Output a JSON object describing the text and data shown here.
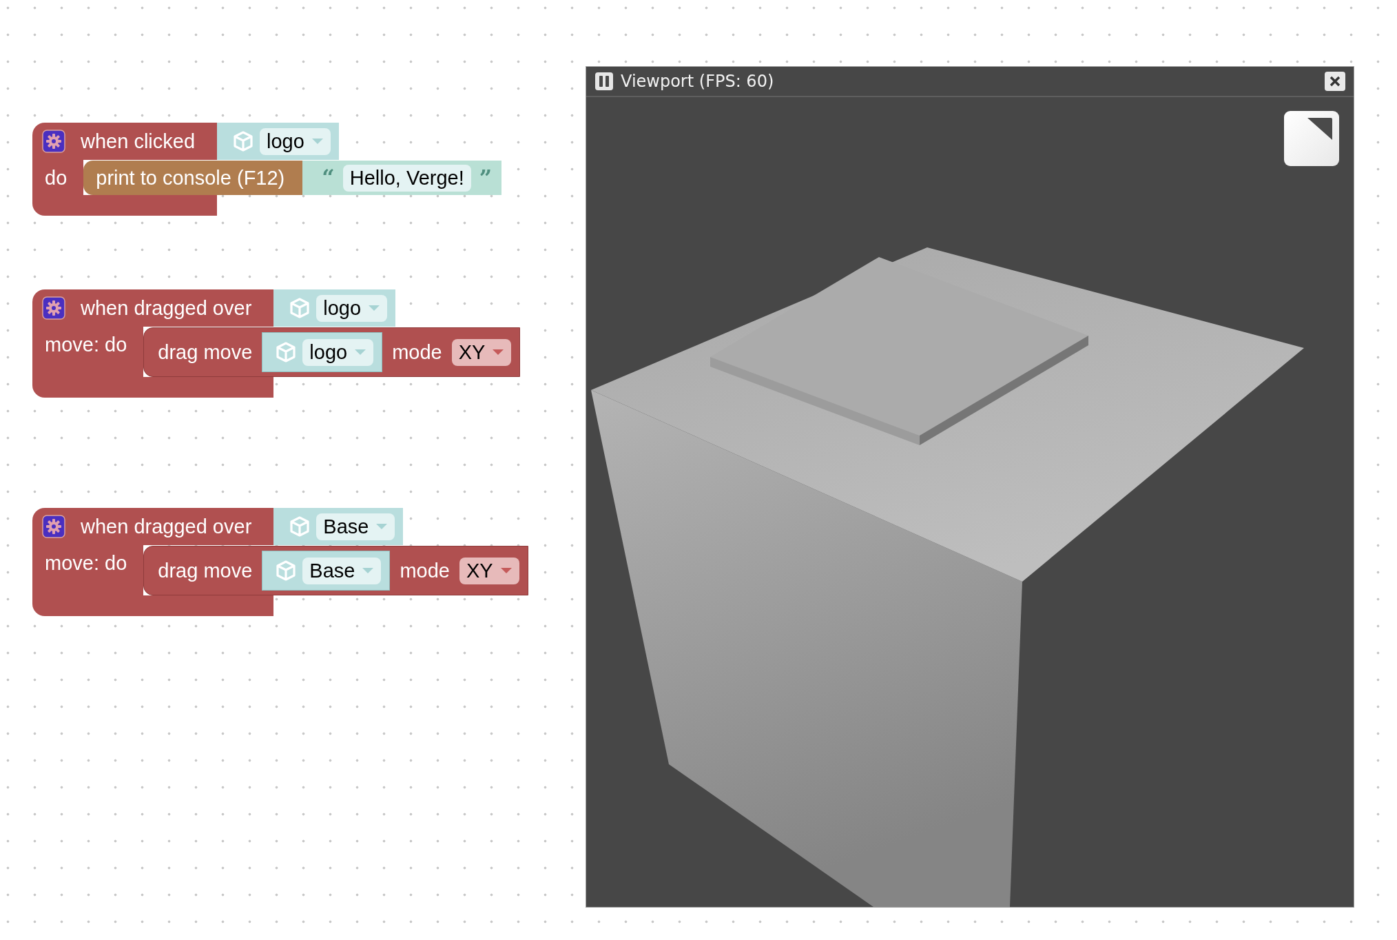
{
  "workspace": {
    "blocks": [
      {
        "kind": "event",
        "title": "when clicked",
        "target": {
          "value": "logo"
        },
        "body_label": "do",
        "statement": {
          "kind": "print",
          "label": "print to console (F12)",
          "text": {
            "open_quote": "“",
            "value": "Hello, Verge!",
            "close_quote": "”"
          }
        }
      },
      {
        "kind": "event",
        "title": "when dragged over",
        "target": {
          "value": "logo"
        },
        "body_label": "move: do",
        "statement": {
          "kind": "drag",
          "label": "drag move",
          "target": {
            "value": "logo"
          },
          "mode_label": "mode",
          "mode": "XY"
        }
      },
      {
        "kind": "event",
        "title": "when dragged over",
        "target": {
          "value": "Base"
        },
        "body_label": "move: do",
        "statement": {
          "kind": "drag",
          "label": "drag move",
          "target": {
            "value": "Base"
          },
          "mode_label": "mode",
          "mode": "XY"
        }
      }
    ]
  },
  "viewport": {
    "title": "Viewport (FPS: 60)"
  }
}
